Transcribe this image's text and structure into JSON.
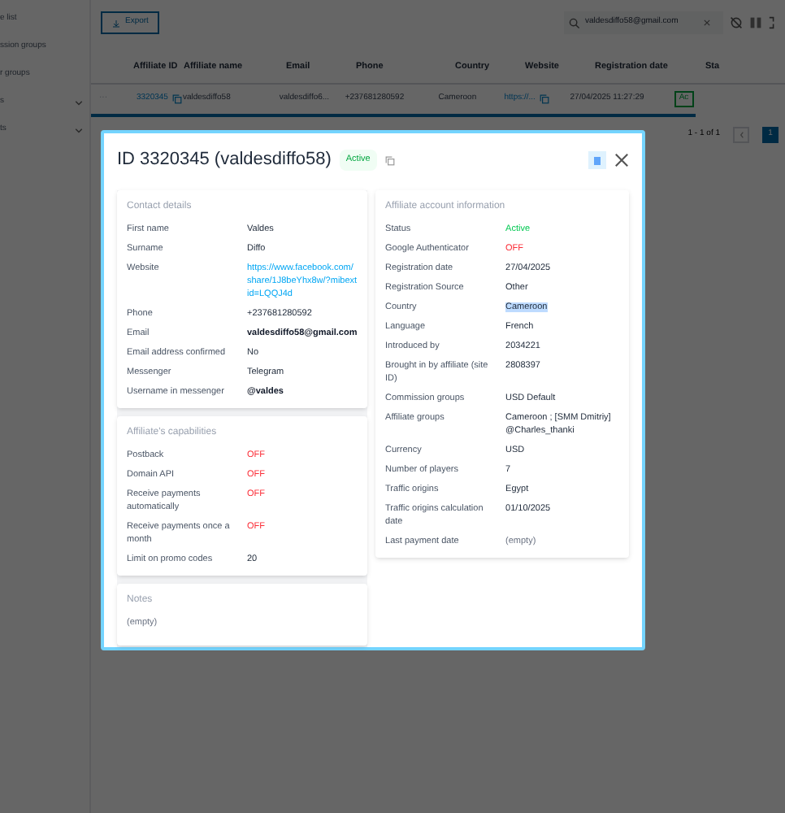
{
  "sidebar": {
    "items": [
      {
        "label": "e list",
        "expandable": false
      },
      {
        "label": "ssion groups",
        "expandable": false
      },
      {
        "label": "r groups",
        "expandable": false
      },
      {
        "label": "s",
        "expandable": true
      },
      {
        "label": "ts",
        "expandable": true
      }
    ]
  },
  "toolbar": {
    "export_button": "Export",
    "search": {
      "value": "valdesdiffo58@gmail.com"
    }
  },
  "table": {
    "columns": [
      "Affiliate ID",
      "Affiliate name",
      "Email",
      "Phone",
      "Country",
      "Website",
      "Registration date",
      "Sta"
    ],
    "rows": [
      {
        "menu": "···",
        "id": "3320345",
        "name": "valdesdiffo58",
        "email": "valdesdiffo6...",
        "phone": "+237681280592",
        "country": "Cameroon",
        "website": "https://...",
        "registration_date": "27/04/2025 11:27:29",
        "status": "Ac"
      }
    ]
  },
  "pagination": {
    "summary": "1 - 1 of 1",
    "pages": [
      {
        "label": "1",
        "selected": true
      }
    ]
  },
  "modal": {
    "title": "ID 3320345 (valdesdiffo58)",
    "status_badge": "Active",
    "left_sections": [
      {
        "title": "Contact details",
        "rows": [
          {
            "label": "First name",
            "value": "Valdes",
            "kind": "text"
          },
          {
            "label": "Surname",
            "value": "Diffo",
            "kind": "text"
          },
          {
            "label": "Website",
            "value": "https://www.facebook.com/share/1J8beYhx8w/?mibextid=LQQJ4d",
            "kind": "link"
          },
          {
            "label": "Phone",
            "value": "+237681280592",
            "kind": "text"
          },
          {
            "label": "Email",
            "value": "valdesdiffo58@gmail.com",
            "kind": "strong"
          },
          {
            "label": "Email address confirmed",
            "value": "No",
            "kind": "text"
          },
          {
            "label": "Messenger",
            "value": "Telegram",
            "kind": "text"
          },
          {
            "label": "Username in messenger",
            "value": "@valdes",
            "kind": "strong"
          }
        ]
      },
      {
        "title": "Affiliate's capabilities",
        "rows": [
          {
            "label": "Postback",
            "value": "OFF",
            "kind": "off"
          },
          {
            "label": "Domain API",
            "value": "OFF",
            "kind": "off"
          },
          {
            "label": "Receive payments automatically",
            "value": "OFF",
            "kind": "off"
          },
          {
            "label": "Receive payments once a month",
            "value": "OFF",
            "kind": "off"
          },
          {
            "label": "Limit on promo codes",
            "value": "20",
            "kind": "text"
          }
        ]
      },
      {
        "title": "Notes",
        "note": "(empty)"
      }
    ],
    "right_sections": [
      {
        "title": "Affiliate account information",
        "rows": [
          {
            "label": "Status",
            "value": "Active",
            "kind": "on"
          },
          {
            "label": "Google Authenticator",
            "value": "OFF",
            "kind": "off"
          },
          {
            "label": "Registration date",
            "value": "27/04/2025",
            "kind": "text"
          },
          {
            "label": "Registration Source",
            "value": "Other",
            "kind": "text"
          },
          {
            "label": "Country",
            "value": "Cameroon",
            "kind": "highlighted"
          },
          {
            "label": "Language",
            "value": "French",
            "kind": "text"
          },
          {
            "label": "Introduced by",
            "value": "2034221",
            "kind": "text"
          },
          {
            "label": "Brought in by affiliate (site ID)",
            "value": "2808397",
            "kind": "text"
          },
          {
            "label": "Commission groups",
            "value": "USD Default",
            "kind": "text"
          },
          {
            "label": "Affiliate groups",
            "value": "Cameroon ; [SMM Dmitriy] @Charles_thanki",
            "kind": "text"
          },
          {
            "label": "Currency",
            "value": "USD",
            "kind": "text"
          },
          {
            "label": "Number of players",
            "value": "7",
            "kind": "text"
          },
          {
            "label": "Traffic origins",
            "value": "Egypt",
            "kind": "text"
          },
          {
            "label": "Traffic origins calculation date",
            "value": "01/10/2025",
            "kind": "text"
          },
          {
            "label": "Last payment date",
            "value": "(empty)",
            "kind": "empty"
          }
        ]
      }
    ]
  }
}
